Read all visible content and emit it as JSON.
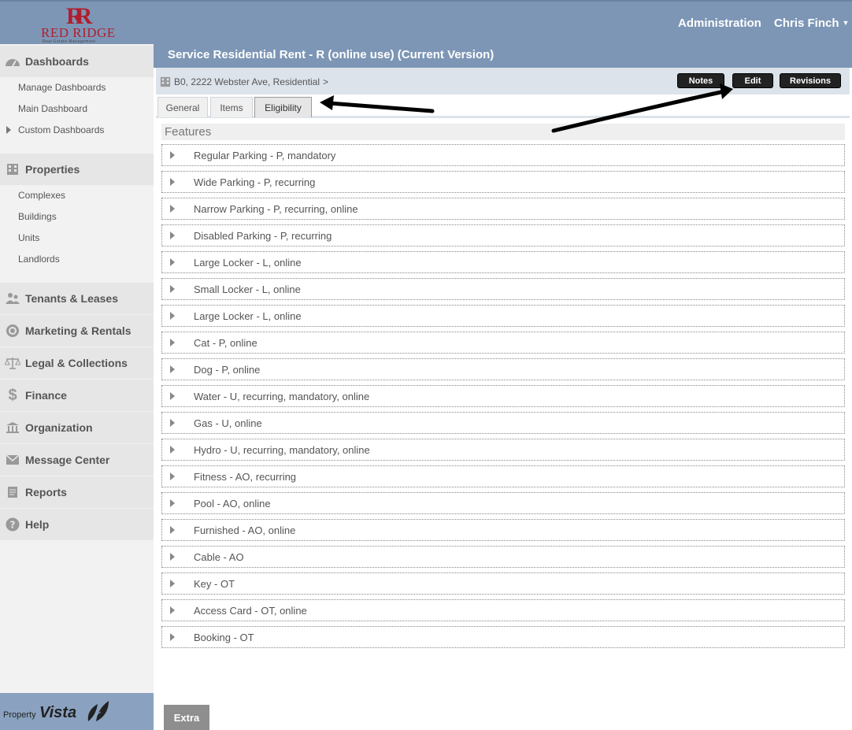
{
  "header": {
    "logo_mark": "RR",
    "logo_text": "RED RIDGE",
    "logo_sub": "Real Estate Management",
    "admin_label": "Administration",
    "user_name": "Chris Finch",
    "user_caret": "▼"
  },
  "sidebar": {
    "sections": [
      {
        "label": "Dashboards",
        "icon": "dashboard-icon"
      },
      {
        "label": "Properties",
        "icon": "building-icon"
      },
      {
        "label": "Tenants & Leases",
        "icon": "people-icon"
      },
      {
        "label": "Marketing & Rentals",
        "icon": "target-icon"
      },
      {
        "label": "Legal & Collections",
        "icon": "scales-icon"
      },
      {
        "label": "Finance",
        "icon": "dollar-icon"
      },
      {
        "label": "Organization",
        "icon": "institution-icon"
      },
      {
        "label": "Message Center",
        "icon": "envelope-icon"
      },
      {
        "label": "Reports",
        "icon": "report-icon"
      },
      {
        "label": "Help",
        "icon": "help-icon"
      }
    ],
    "dashboard_items": [
      "Manage Dashboards",
      "Main Dashboard",
      "Custom Dashboards"
    ],
    "property_items": [
      "Complexes",
      "Buildings",
      "Units",
      "Landlords"
    ],
    "footer_property": "Property",
    "footer_vista": "Vista"
  },
  "main": {
    "title": "Service Residential Rent - R (online use) (Current Version)",
    "breadcrumb": "B0, 2222 Webster Ave, Residential",
    "breadcrumb_sep": ">",
    "buttons": {
      "notes": "Notes",
      "edit": "Edit",
      "revisions": "Revisions"
    },
    "tabs": [
      "General",
      "Items",
      "Eligibility"
    ],
    "active_tab": "Eligibility",
    "features_header": "Features",
    "features": [
      "Regular Parking - P, mandatory",
      "Wide Parking - P, recurring",
      "Narrow Parking - P, recurring, online",
      "Disabled Parking - P, recurring",
      "Large Locker - L, online",
      "Small Locker - L, online",
      "Large Locker - L, online",
      "Cat - P, online",
      "Dog - P, online",
      "Water - U, recurring, mandatory, online",
      "Gas - U, online",
      "Hydro - U, recurring, mandatory, online",
      "Fitness - AO, recurring",
      "Pool - AO, online",
      "Furnished - AO, online",
      "Cable - AO",
      "Key - OT",
      "Access Card - OT, online",
      "Booking - OT"
    ],
    "extra_label": "Extra"
  }
}
